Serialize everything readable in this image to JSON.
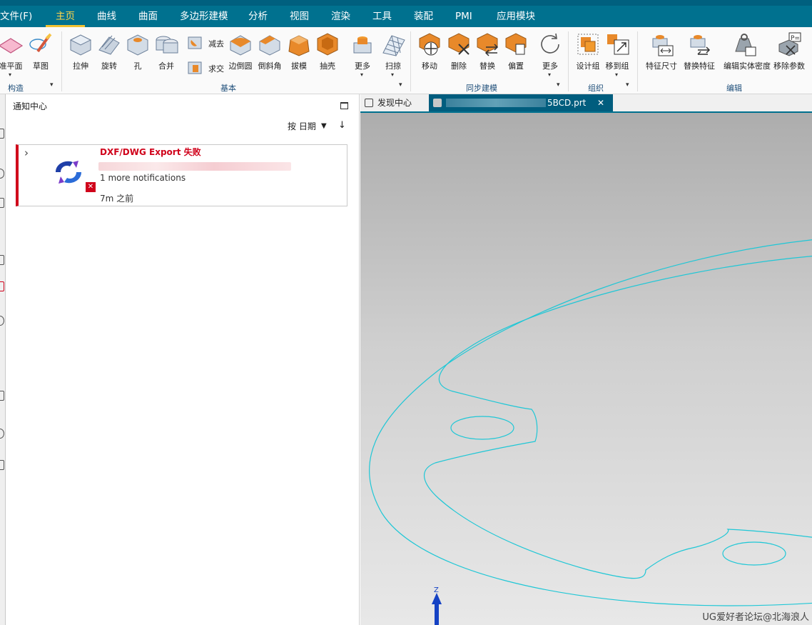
{
  "menubar": {
    "file": "文件(F)",
    "tabs": [
      "主页",
      "曲线",
      "曲面",
      "多边形建模",
      "分析",
      "视图",
      "渲染",
      "工具",
      "装配",
      "PMI",
      "应用模块"
    ],
    "active_tab": "主页"
  },
  "ribbon": {
    "construct": {
      "datum_plane": "准平面",
      "sketch": "草图",
      "group": "构造"
    },
    "basic": {
      "extrude": "拉伸",
      "revolve": "旋转",
      "hole": "孔",
      "unite": "合并",
      "subtract": "减去",
      "intersect": "求交",
      "edge_blend": "边倒圆",
      "chamfer": "倒斜角",
      "draft": "拔模",
      "shell": "抽壳",
      "more": "更多",
      "sweep": "扫掠",
      "group": "基本"
    },
    "sync": {
      "move": "移动",
      "delete": "删除",
      "replace": "替换",
      "offset": "偏置",
      "more": "更多",
      "group": "同步建模"
    },
    "organize": {
      "design_group": "设计组",
      "move_to_group": "移到组",
      "group": "组织"
    },
    "edit": {
      "feature_dim": "特征尺寸",
      "replace_feature": "替换特征",
      "edit_density": "编辑实体密度",
      "remove_params": "移除参数",
      "group": "编辑"
    }
  },
  "notification_panel": {
    "title": "通知中心",
    "sort_label": "按 日期",
    "sort_direction": "↓",
    "card": {
      "title": "DXF/DWG Export 失败",
      "more": "1 more notifications",
      "time": "7m 之前"
    }
  },
  "viewport": {
    "tabs": {
      "discover": "发现中心",
      "part": "5BCD.prt"
    },
    "axis_label": "Z",
    "watermark": "UG爱好者论坛@北海浪人"
  },
  "colors": {
    "menubar": "#00718f",
    "accent": "#f1c232",
    "error": "#d0021b",
    "curve": "#1fc7d6"
  }
}
